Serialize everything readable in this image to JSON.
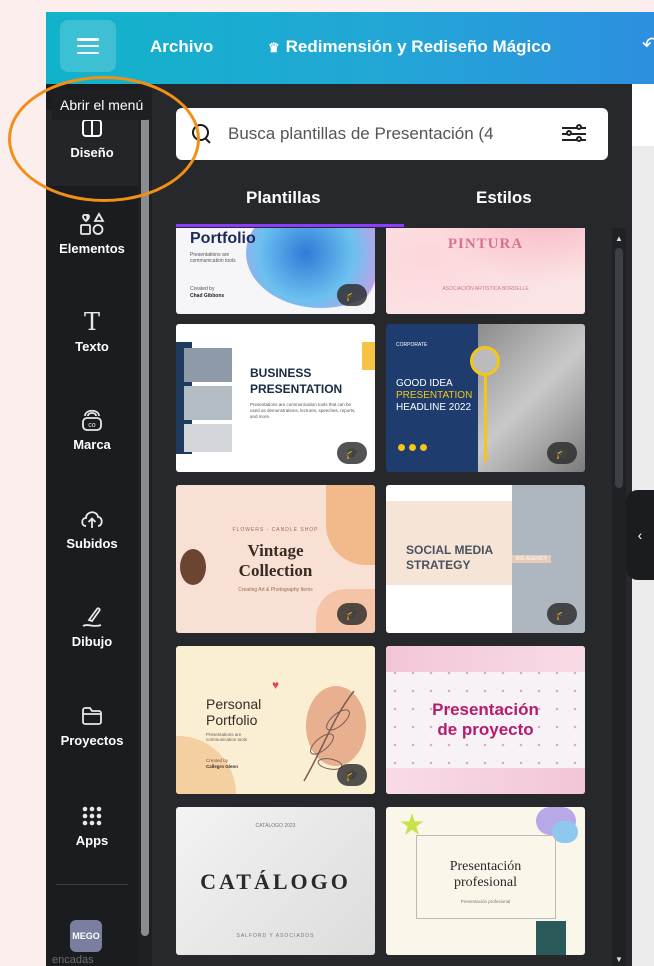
{
  "topbar": {
    "file_label": "Archivo",
    "magic_label": "Redimensión y Rediseño Mágico",
    "crown_icon": "crown-icon",
    "menu_icon": "hamburger-menu-icon"
  },
  "tooltip": {
    "text": "Abrir el menú"
  },
  "sidebar": {
    "items": [
      {
        "label": "Diseño",
        "icon": "design-icon"
      },
      {
        "label": "Elementos",
        "icon": "elements-icon"
      },
      {
        "label": "Texto",
        "icon": "text-icon"
      },
      {
        "label": "Marca",
        "icon": "brand-icon"
      },
      {
        "label": "Subidos",
        "icon": "upload-cloud-icon"
      },
      {
        "label": "Dibujo",
        "icon": "draw-icon"
      },
      {
        "label": "Proyectos",
        "icon": "folder-icon"
      },
      {
        "label": "Apps",
        "icon": "apps-grid-icon"
      }
    ],
    "app_badge": "MEGO",
    "app_label": "encadas"
  },
  "search": {
    "placeholder": "Busca plantillas de Presentación (4"
  },
  "tabs": [
    {
      "label": "Plantillas",
      "active": true
    },
    {
      "label": "Estilos",
      "active": false
    }
  ],
  "templates": {
    "portfolio": {
      "title": "Portfolio",
      "sub": "Presentations are communication tools",
      "by": "Created by",
      "by2": "Chad Gibbons"
    },
    "pintura": {
      "title": "PINTURA",
      "sub": "ASOCIACIÓN ARTÍSTICA BORDELLE"
    },
    "business": {
      "title1": "BUSINESS",
      "title2": "PRESENTATION",
      "sub": "Presentations are communication tools that can be used as demonstrations, lectures, speeches, reports, and more."
    },
    "corporate": {
      "tag": "CORPORATE",
      "l1": "GOOD IDEA",
      "l2": "PRESENTATION",
      "l3": "HEADLINE 2022"
    },
    "vintage": {
      "kicker": "FLOWERS - CANDLE SHOP",
      "l1": "Vintage",
      "l2": "Collection",
      "sub": "Creating Art & Photography Items"
    },
    "social": {
      "l1": "SOCIAL MEDIA",
      "l2": "STRATEGY",
      "tag": "BIG AGENCY"
    },
    "personal": {
      "l1": "Personal",
      "l2": "Portfolio",
      "sub": "Presentations are communication tools",
      "by": "Created by",
      "by2": "Callegro Glenn"
    },
    "proyecto": {
      "l1": "Presentación",
      "l2": "de proyecto"
    },
    "catalogo": {
      "top": "CATÁLOGO 2023",
      "title": "CATÁLOGO",
      "sub": "SALFORD Y ASOCIADOS"
    },
    "profesional": {
      "l1": "Presentación",
      "l2": "profesional",
      "sub": "Presentación profesional"
    }
  },
  "colors": {
    "accent": "#8b3dff",
    "topbar": "#11b3c9",
    "highlight": "#f28f18"
  }
}
